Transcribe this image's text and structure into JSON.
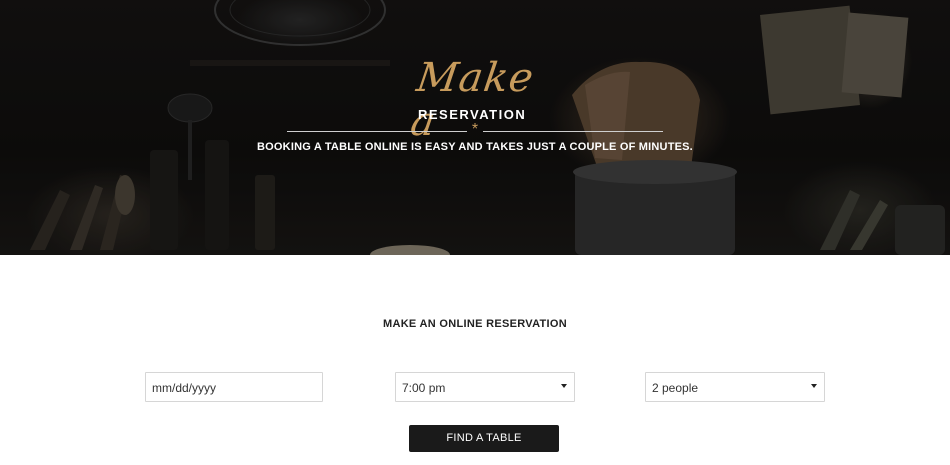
{
  "hero": {
    "script_title": "Make a",
    "title": "RESERVATION",
    "divider_glyph": "*",
    "subtitle": "BOOKING A TABLE ONLINE IS EASY AND TAKES JUST A COUPLE OF MINUTES.",
    "accent_color": "#c79b5c"
  },
  "form": {
    "heading": "MAKE AN ONLINE RESERVATION",
    "date": {
      "placeholder": "mm/dd/yyyy"
    },
    "time": {
      "value": "7:00 pm"
    },
    "party": {
      "value": "2 people"
    },
    "submit_label": "FIND A TABLE",
    "button_color": "#1a1a1a"
  },
  "icons": {
    "select_arrow": "chevron-down-icon",
    "divider": "star-icon"
  }
}
